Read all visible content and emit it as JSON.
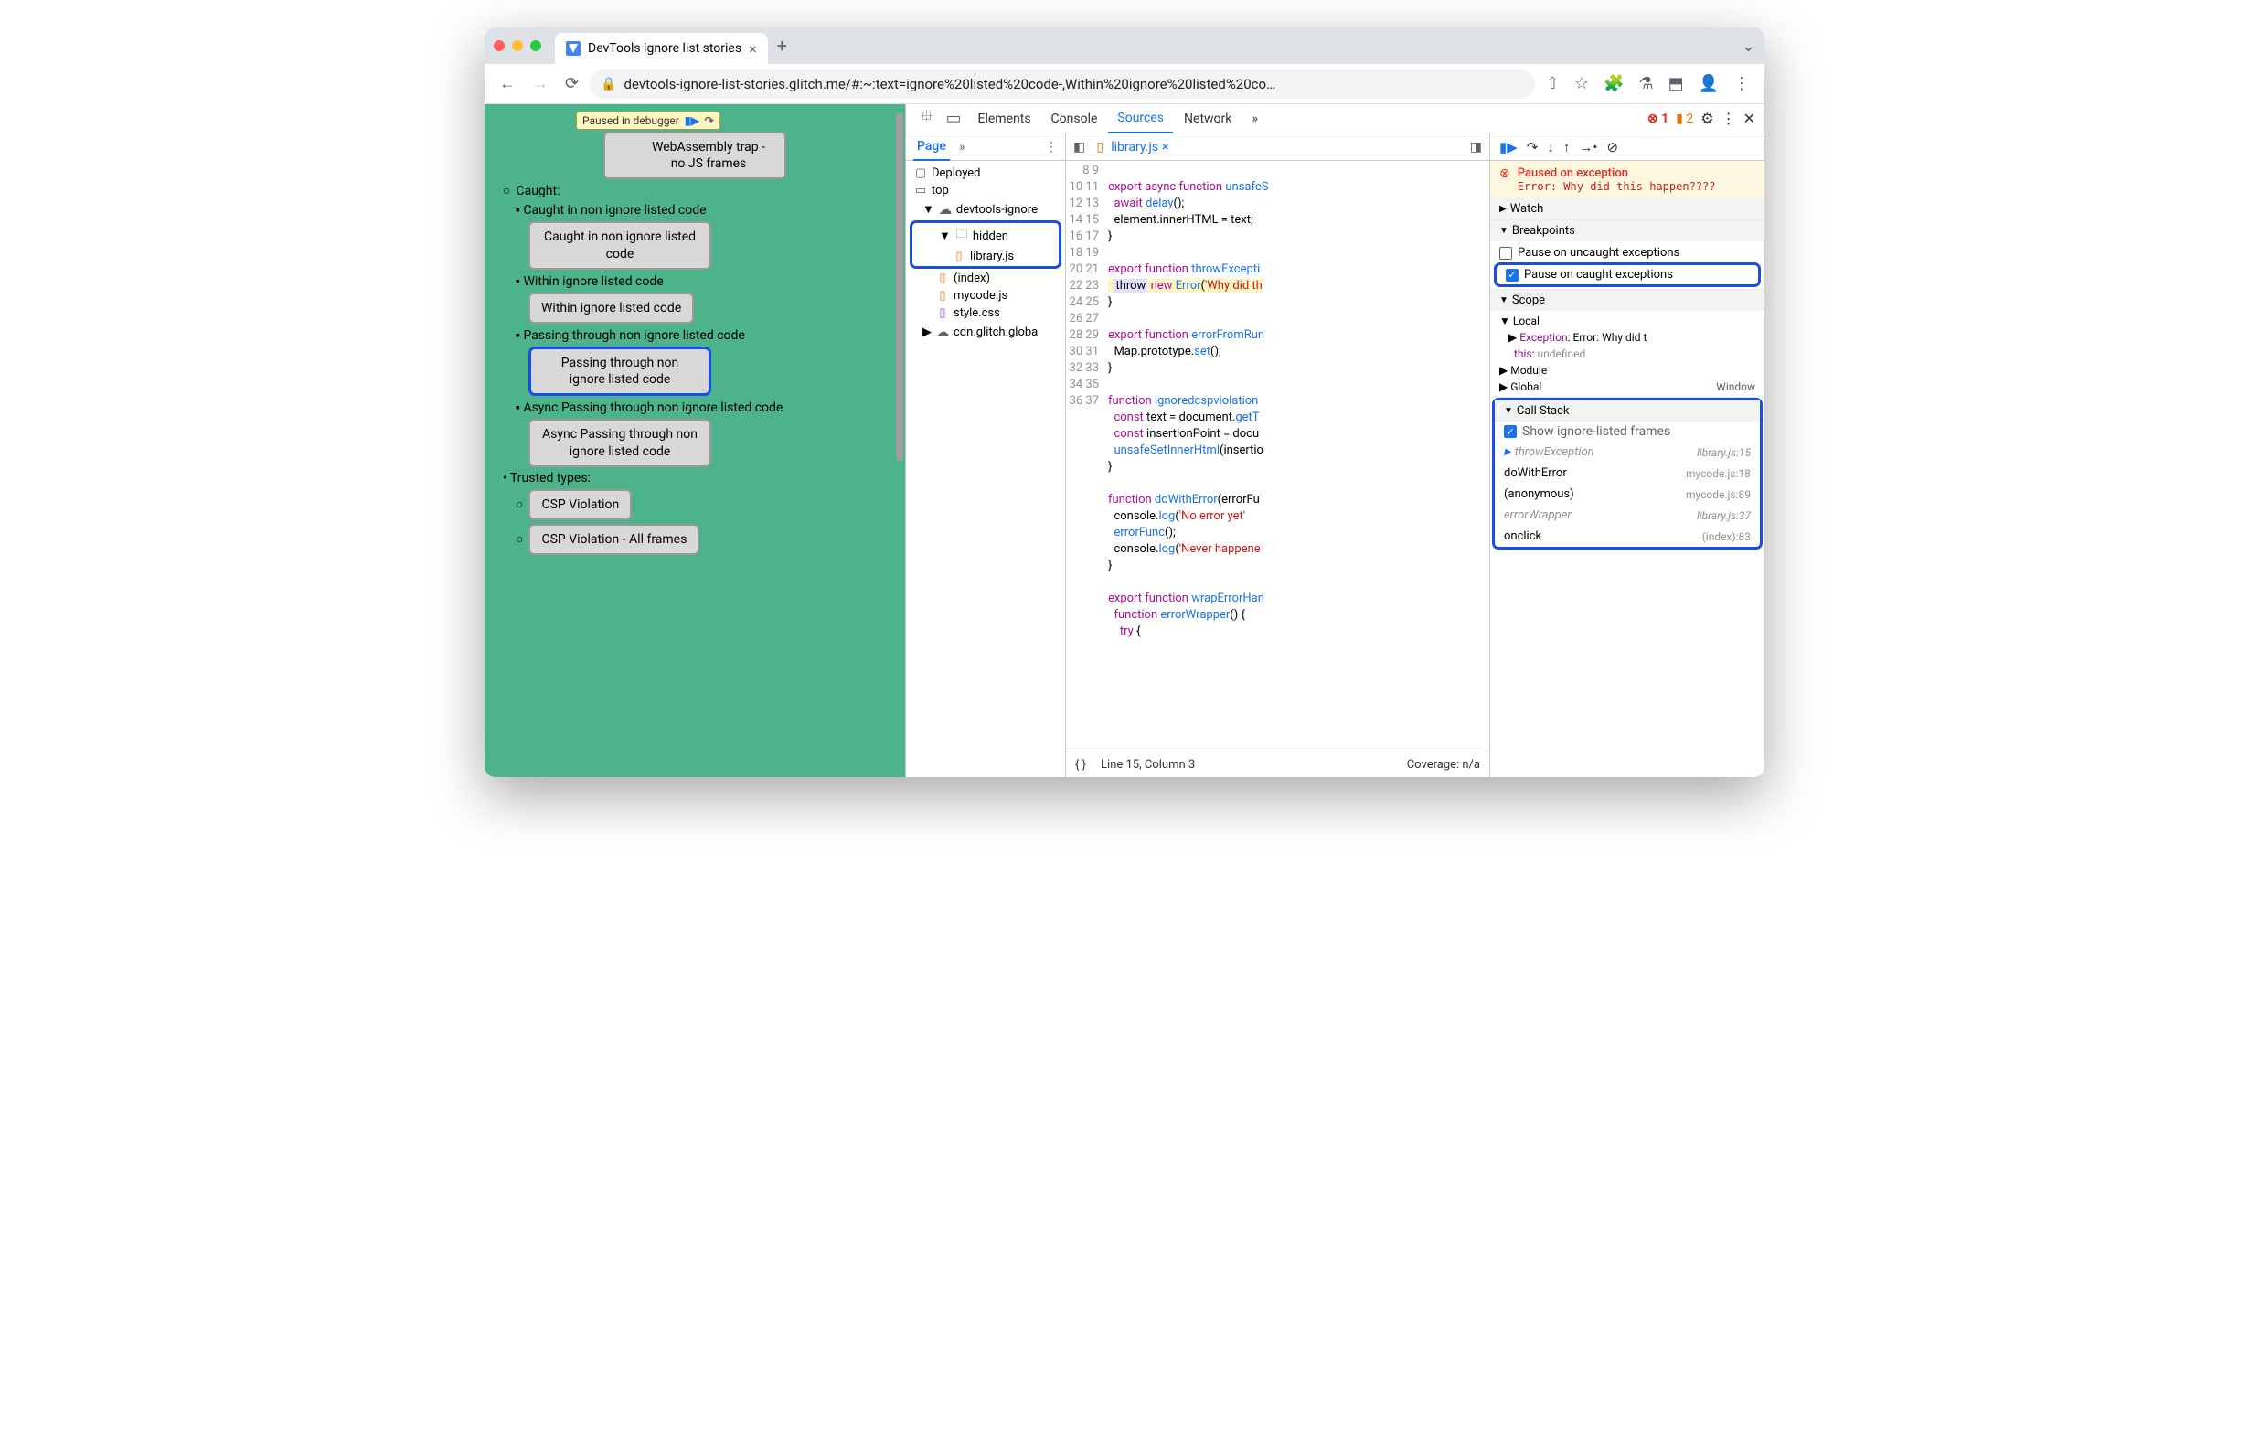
{
  "browser": {
    "tab_title": "DevTools ignore list stories",
    "url": "devtools-ignore-list-stories.glitch.me/#:~:text=ignore%20listed%20code-,Within%20ignore%20listed%20co…"
  },
  "page": {
    "paused_label": "Paused in debugger",
    "caught_label": "Caught:",
    "items": {
      "wasm": "WebAssembly trap - no JS frames",
      "caught_non_ignore": "Caught in non ignore listed code",
      "caught_non_ignore_btn": "Caught in non ignore listed code",
      "within_ignore": "Within ignore listed code",
      "within_ignore_btn": "Within ignore listed code",
      "passing_through": "Passing through non ignore listed code",
      "passing_through_btn": "Passing through non ignore listed code",
      "async_passing": "Async Passing through non ignore listed code",
      "async_passing_btn": "Async Passing through non ignore listed code",
      "trusted_types": "Trusted types:",
      "csp_violation": "CSP Violation",
      "csp_violation_all": "CSP Violation - All frames"
    }
  },
  "devtools": {
    "tabs": {
      "elements": "Elements",
      "console": "Console",
      "sources": "Sources",
      "network": "Network"
    },
    "error_count": "1",
    "issue_count": "2",
    "sources": {
      "left_tab": "Page",
      "tree": {
        "deployed": "Deployed",
        "top": "top",
        "origin": "devtools-ignore",
        "hidden": "hidden",
        "library": "library.js",
        "index": "(index)",
        "mycode": "mycode.js",
        "style": "style.css",
        "cdn": "cdn.glitch.globa"
      },
      "editor": {
        "filename": "library.js",
        "status_line": "Line 15, Column 3",
        "coverage": "Coverage: n/a",
        "gutter_start": 8,
        "gutter_end": 37,
        "lines": {
          "l8": "export async function unsafeS",
          "l9": "  await delay();",
          "l10": "  element.innerHTML = text;",
          "l11": "}",
          "l12": "",
          "l13": "",
          "l14": "export function throwExcepti",
          "l15a": "throw",
          "l15b": " new Error('Why did th",
          "l16": "}",
          "l17": "",
          "l18": "export function errorFromRun",
          "l19": "  Map.prototype.set();",
          "l20": "}",
          "l21": "",
          "l22": "function ignoredcspviolation",
          "l23": "  const text = document.getT",
          "l24": "  const insertionPoint = docu",
          "l25": "  unsafeSetInnerHtml(insertio",
          "l26": "}",
          "l27": "",
          "l28": "function doWithError(errorFu",
          "l29": "  console.log('No error yet'",
          "l30": "  errorFunc();",
          "l31": "  console.log('Never happene",
          "l32": "}",
          "l33": "",
          "l34": "export function wrapErrorHan",
          "l35": "  function errorWrapper() {",
          "l36": "    try {"
        }
      }
    },
    "debugger": {
      "paused_title": "Paused on exception",
      "paused_error": "Error: Why did this happen????",
      "sections": {
        "watch": "Watch",
        "breakpoints": "Breakpoints",
        "scope": "Scope",
        "callstack": "Call Stack"
      },
      "breakpoints": {
        "uncaught": "Pause on uncaught exceptions",
        "caught": "Pause on caught exceptions"
      },
      "scope": {
        "local": "Local",
        "exception_label": "Exception",
        "exception_value": "Error: Why did t",
        "this_label": "this",
        "this_value": "undefined",
        "module": "Module",
        "global": "Global",
        "global_value": "Window"
      },
      "callstack": {
        "show_ignored": "Show ignore-listed frames",
        "frames": [
          {
            "name": "throwException",
            "loc": "library.js:15",
            "ignored": true,
            "current": true
          },
          {
            "name": "doWithError",
            "loc": "mycode.js:18",
            "ignored": false,
            "current": false
          },
          {
            "name": "(anonymous)",
            "loc": "mycode.js:89",
            "ignored": false,
            "current": false
          },
          {
            "name": "errorWrapper",
            "loc": "library.js:37",
            "ignored": true,
            "current": false
          },
          {
            "name": "onclick",
            "loc": "(index):83",
            "ignored": false,
            "current": false
          }
        ]
      }
    }
  }
}
